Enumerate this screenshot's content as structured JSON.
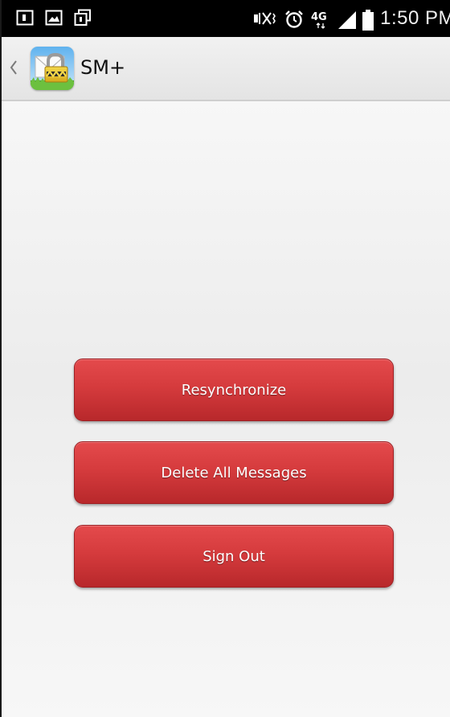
{
  "status_bar": {
    "time": "1:50 PM",
    "network_label": "4G",
    "left_icons": [
      "notification-square-icon",
      "image-icon",
      "copy-icon"
    ],
    "right_icons": [
      "mute-vibrate-icon",
      "alarm-icon",
      "network-4g-icon",
      "signal-icon",
      "battery-icon"
    ]
  },
  "action_bar": {
    "title": "SM+",
    "logo": "app-logo-lock-envelope"
  },
  "buttons": {
    "resync": "Resynchronize",
    "delete_all": "Delete All Messages",
    "sign_out": "Sign Out"
  },
  "colors": {
    "button_red": "#d53b3d",
    "status_bar": "#000000",
    "action_bar": "#eaeaea"
  }
}
